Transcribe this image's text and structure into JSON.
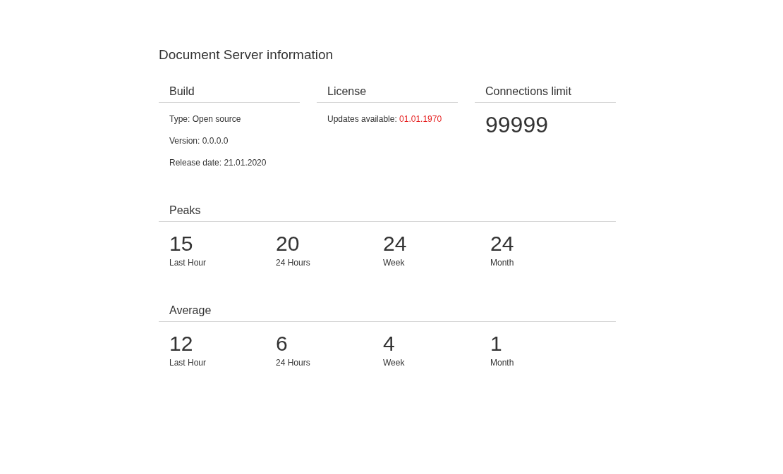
{
  "title": "Document Server information",
  "build": {
    "heading": "Build",
    "lines": [
      "Type: Open source",
      "Version: 0.0.0.0",
      "Release date: 21.01.2020"
    ]
  },
  "license": {
    "heading": "License",
    "label": "Updates available:",
    "date": "01.01.1970"
  },
  "connections": {
    "heading": "Connections limit",
    "value": "99999"
  },
  "sections": [
    {
      "heading": "Peaks",
      "stats": [
        {
          "value": "15",
          "label": "Last Hour"
        },
        {
          "value": "20",
          "label": "24 Hours"
        },
        {
          "value": "24",
          "label": "Week"
        },
        {
          "value": "24",
          "label": "Month"
        }
      ]
    },
    {
      "heading": "Average",
      "stats": [
        {
          "value": "12",
          "label": "Last Hour"
        },
        {
          "value": "6",
          "label": "24 Hours"
        },
        {
          "value": "4",
          "label": "Week"
        },
        {
          "value": "1",
          "label": "Month"
        }
      ]
    }
  ]
}
